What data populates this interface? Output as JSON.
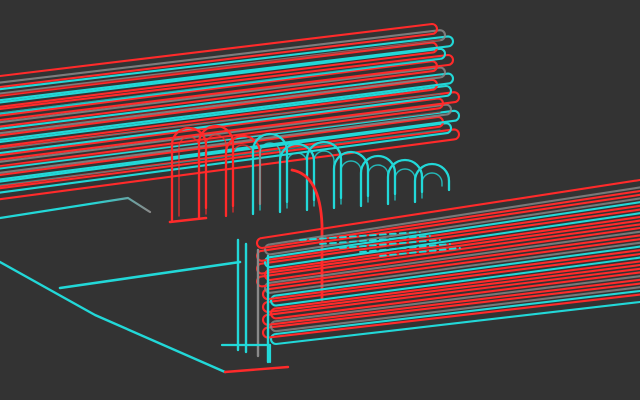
{
  "scene": {
    "background": "#333333",
    "colors": {
      "red": "#ff2a2a",
      "cyan": "#22d8d8",
      "gray": "#8a8a8a",
      "dark_red": "#b21a1a",
      "dark_cyan": "#1a9e9e"
    },
    "upper_tube_bundle": {
      "tube_count": 18,
      "color_pattern": [
        "red",
        "gray",
        "cyan",
        "red",
        "cyan",
        "red"
      ]
    },
    "lower_tube_bundle": {
      "tube_count": 16,
      "color_pattern": [
        "red",
        "gray",
        "red",
        "cyan",
        "red",
        "red"
      ]
    },
    "vertical_loops": {
      "count": 10,
      "colors": [
        "red",
        "red",
        "red",
        "cyan",
        "cyan",
        "cyan",
        "cyan",
        "cyan",
        "cyan",
        "cyan"
      ]
    }
  }
}
